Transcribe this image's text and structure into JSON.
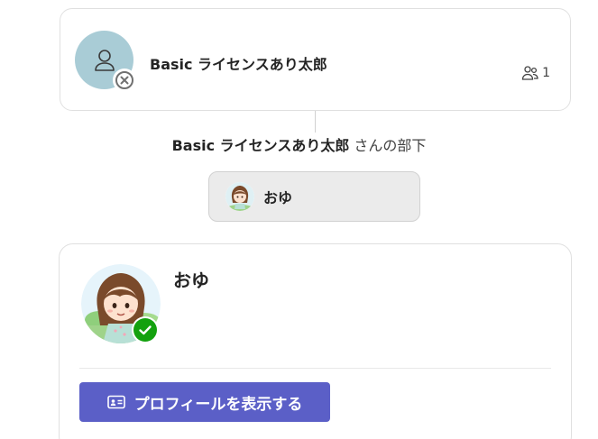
{
  "manager": {
    "name": "Basic ライセンスあり太郎",
    "presence": "offline",
    "direct_reports_count": "1",
    "avatar_icon": "person-icon",
    "avatar_color": "#a9ccd6"
  },
  "reports_section": {
    "manager_name": "Basic ライセンスあり太郎",
    "suffix": " さんの部下"
  },
  "direct_report": {
    "name": "おゆ"
  },
  "selected_person": {
    "name": "おゆ",
    "presence": "available",
    "presence_color": "#13a10e",
    "profile_button_label": "プロフィールを表示する",
    "profile_button_icon": "contact-card-icon",
    "accent_color": "#5b5fc7"
  }
}
